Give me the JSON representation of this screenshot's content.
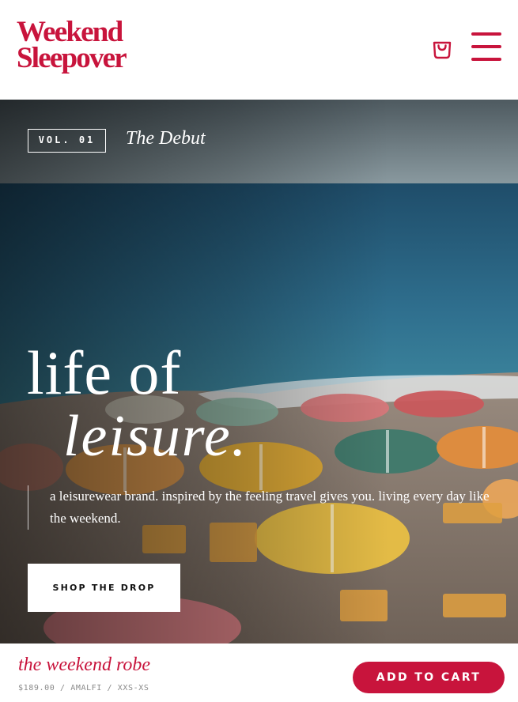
{
  "brand": {
    "logo_line1": "Weekend",
    "logo_line2": "Sleepover",
    "color": "#c8143c"
  },
  "header": {
    "bag_icon": "shopping-bag-icon",
    "menu_icon": "hamburger-menu-icon"
  },
  "hero": {
    "volume": "VOL. 01",
    "issue_title": "The Debut",
    "headline_line1": "life of",
    "headline_line2": "leisure.",
    "tagline": "a leisurewear brand. inspired by the feeling travel gives you. living every day like the weekend.",
    "cta_label": "SHOP THE DROP"
  },
  "sticky_bar": {
    "product_name": "the weekend robe",
    "product_meta": "$189.00 / AMALFI / XXS-XS",
    "add_to_cart_label": "ADD TO CART"
  }
}
